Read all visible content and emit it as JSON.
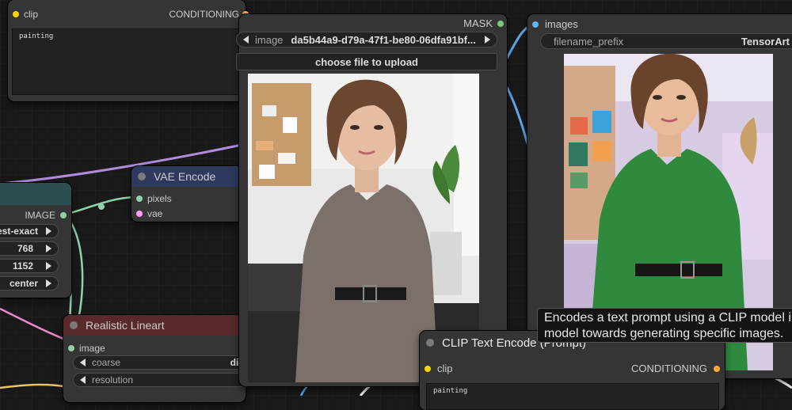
{
  "colors": {
    "canvas": "#191919",
    "node_body": "#353535",
    "clip_socket": "#ffd500",
    "conditioning_socket": "#ffa931",
    "image_socket": "#64b5f6",
    "latent_socket": "#ff9cf9",
    "vae_socket": "#ff6e6e",
    "mask_socket": "#81c784"
  },
  "top_clip_node": {
    "input_clip": "clip",
    "output_conditioning": "CONDITIONING",
    "text": "painting"
  },
  "vae_encode": {
    "title": "VAE Encode",
    "input_pixels": "pixels",
    "input_vae": "vae"
  },
  "resize_node": {
    "output_image": "IMAGE",
    "widgets": [
      "est-exact",
      "768",
      "1152",
      "center"
    ]
  },
  "realistic_lineart": {
    "title": "Realistic Lineart",
    "input_image": "image",
    "widget_coarse_label": "coarse",
    "widget_coarse_value": "dis",
    "widget_resolution_label": "resolution"
  },
  "load_image": {
    "output_mask": "MASK",
    "image_label": "image",
    "image_value": "da5b44a9-d79a-47f1-be80-06dfa91bf...",
    "upload_button": "choose file to upload"
  },
  "save_image": {
    "input_images": "images",
    "filename_label": "filename_prefix",
    "filename_value": "TensorArt"
  },
  "clip_text_encode": {
    "title": "CLIP Text Encode (Prompt)",
    "input_clip": "clip",
    "output_conditioning": "CONDITIONING",
    "text": "painting"
  },
  "tooltip": {
    "line1": "Encodes a text prompt using a CLIP model in",
    "line2": "model towards generating specific images."
  }
}
